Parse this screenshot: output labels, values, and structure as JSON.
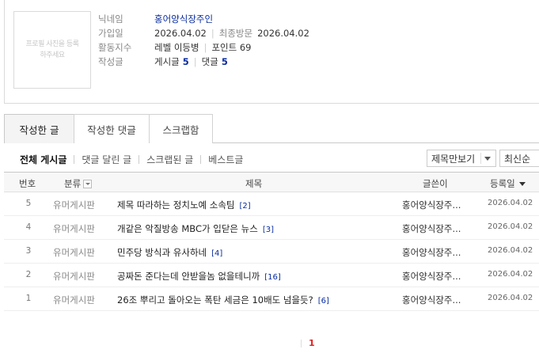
{
  "profile": {
    "avatar_placeholder": "프로필 사진을 등록하주세요",
    "nickname_label": "닉네임",
    "nickname": "홍어양식장주인",
    "joined_label": "가입일",
    "joined": "2026.04.02",
    "last_visit_label": "최종방문",
    "last_visit": "2026.04.02",
    "activity_label": "활동지수",
    "level": "레벨 이등병",
    "points": "포인트 69",
    "written_label": "작성글",
    "posts_label": "게시글",
    "posts_count": "5",
    "comments_label": "댓글",
    "comments_count": "5"
  },
  "tabs": [
    "작성한 글",
    "작성한 댓글",
    "스크랩함"
  ],
  "filters": [
    "전체 게시글",
    "댓글 달린 글",
    "스크랩된 글",
    "베스트글"
  ],
  "view_select": "제목만보기",
  "sort_select": "최신순",
  "table": {
    "headers": {
      "num": "번호",
      "category": "분류",
      "title": "제목",
      "author": "글쓴이",
      "date": "등록일"
    },
    "rows": [
      {
        "num": "5",
        "category": "유머게시판",
        "title": "제목 따라하는 정치노예 소속팀",
        "comments": "[2]",
        "author": "홍어양식장주...",
        "date": "2026.04.02"
      },
      {
        "num": "4",
        "category": "유머게시판",
        "title": "개같은 악질방송 MBC가 입닫은 뉴스",
        "comments": "[3]",
        "author": "홍어양식장주...",
        "date": "2026.04.02"
      },
      {
        "num": "3",
        "category": "유머게시판",
        "title": "민주당 방식과 유사하네",
        "comments": "[4]",
        "author": "홍어양식장주...",
        "date": "2026.04.02"
      },
      {
        "num": "2",
        "category": "유머게시판",
        "title": "공짜돈 준다는데 안받을놈 없을테니까",
        "comments": "[16]",
        "author": "홍어양식장주...",
        "date": "2026.04.02"
      },
      {
        "num": "1",
        "category": "유머게시판",
        "title": "26조 뿌리고 돌아오는 폭탄 세금은 10배도 넘을듯?",
        "comments": "[6]",
        "author": "홍어양식장주...",
        "date": "2026.04.02"
      }
    ]
  },
  "pagination": {
    "current": "1"
  },
  "colors": {
    "link_blue": "#0a2d9e",
    "page_red": "#e02020"
  }
}
